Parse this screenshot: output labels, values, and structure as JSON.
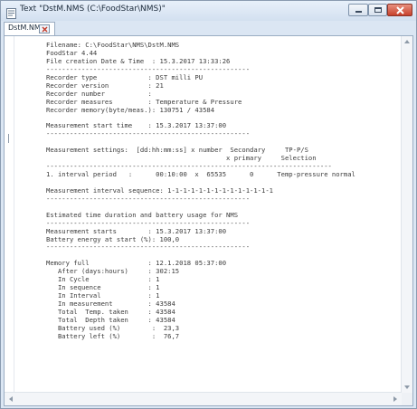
{
  "window": {
    "title": "Text \"DstM.NMS (C:\\FoodStar\\NMS)\"",
    "app_icon": "document-text-icon",
    "controls": {
      "minimize_icon": "minimize-icon",
      "maximize_icon": "maximize-icon",
      "close_icon": "close-icon",
      "close_color": "#c7412c"
    }
  },
  "tab": {
    "label": "DstM.NMS",
    "close_icon": "close-icon"
  },
  "editor": {
    "lines": [
      "Filename: C:\\FoodStar\\NMS\\DstM.NMS",
      "FoodStar 4.44",
      "File creation Date & Time  : 15.3.2017 13:33:26",
      "----------------------------------------------------",
      "Recorder type             : DST milli PU",
      "Recorder version          : 21",
      "Recorder number           :",
      "Recorder measures         : Temperature & Pressure",
      "Recorder memory(byte/meas.): 130751 / 43584",
      "",
      "Measurement start time    : 15.3.2017 13:37:00",
      "----------------------------------------------------",
      "",
      "Measurement settings:  [dd:hh:mm:ss] x number  Secondary     TP-P/S",
      "                                              x primary     Selection",
      "-------------------------------------------------------------------------",
      "1. interval period   :      00:10:00  x  65535      0      Temp-pressure normal",
      "",
      "Measurement interval sequence: 1-1-1-1-1-1-1-1-1-1-1-1-1-1",
      "----------------------------------------------------",
      "",
      "Estimated time duration and battery usage for NMS",
      "----------------------------------------------------",
      "Measurement starts        : 15.3.2017 13:37:00",
      "Battery energy at start (%): 100,0",
      "----------------------------------------------------",
      "",
      "Memory full               : 12.1.2018 05:37:00",
      "   After (days:hours)     : 302:15",
      "   In Cycle               : 1",
      "   In sequence            : 1",
      "   In Interval            : 1",
      "   In measurement         : 43584",
      "   Total  Temp. taken     : 43584",
      "   Total  Depth taken     : 43584",
      "   Battery used (%)        :  23,3",
      "   Battery left (%)        :  76,7"
    ]
  },
  "scrollbars": {
    "up_icon": "scroll-up-arrow-icon",
    "down_icon": "scroll-down-arrow-icon",
    "left_icon": "scroll-left-arrow-icon",
    "right_icon": "scroll-right-arrow-icon"
  }
}
